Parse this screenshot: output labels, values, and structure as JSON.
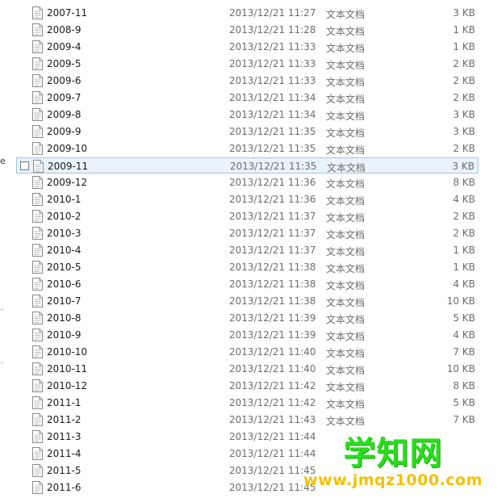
{
  "left_edge": {
    "glyph": "e"
  },
  "files": [
    {
      "name": "2007-11",
      "date": "2013/12/21 11:27",
      "type": "文本文档",
      "size": "3 KB"
    },
    {
      "name": "2008-9",
      "date": "2013/12/21 11:28",
      "type": "文本文档",
      "size": "1 KB"
    },
    {
      "name": "2009-4",
      "date": "2013/12/21 11:33",
      "type": "文本文档",
      "size": "1 KB"
    },
    {
      "name": "2009-5",
      "date": "2013/12/21 11:33",
      "type": "文本文档",
      "size": "2 KB"
    },
    {
      "name": "2009-6",
      "date": "2013/12/21 11:33",
      "type": "文本文档",
      "size": "2 KB"
    },
    {
      "name": "2009-7",
      "date": "2013/12/21 11:34",
      "type": "文本文档",
      "size": "2 KB"
    },
    {
      "name": "2009-8",
      "date": "2013/12/21 11:34",
      "type": "文本文档",
      "size": "3 KB"
    },
    {
      "name": "2009-9",
      "date": "2013/12/21 11:35",
      "type": "文本文档",
      "size": "3 KB"
    },
    {
      "name": "2009-10",
      "date": "2013/12/21 11:35",
      "type": "文本文档",
      "size": "2 KB"
    },
    {
      "name": "2009-11",
      "date": "2013/12/21 11:35",
      "type": "文本文档",
      "size": "3 KB",
      "selected": true
    },
    {
      "name": "2009-12",
      "date": "2013/12/21 11:36",
      "type": "文本文档",
      "size": "8 KB"
    },
    {
      "name": "2010-1",
      "date": "2013/12/21 11:36",
      "type": "文本文档",
      "size": "4 KB"
    },
    {
      "name": "2010-2",
      "date": "2013/12/21 11:37",
      "type": "文本文档",
      "size": "2 KB"
    },
    {
      "name": "2010-3",
      "date": "2013/12/21 11:37",
      "type": "文本文档",
      "size": "2 KB"
    },
    {
      "name": "2010-4",
      "date": "2013/12/21 11:37",
      "type": "文本文档",
      "size": "1 KB"
    },
    {
      "name": "2010-5",
      "date": "2013/12/21 11:38",
      "type": "文本文档",
      "size": "1 KB"
    },
    {
      "name": "2010-6",
      "date": "2013/12/21 11:38",
      "type": "文本文档",
      "size": "4 KB"
    },
    {
      "name": "2010-7",
      "date": "2013/12/21 11:38",
      "type": "文本文档",
      "size": "10 KB"
    },
    {
      "name": "2010-8",
      "date": "2013/12/21 11:39",
      "type": "文本文档",
      "size": "5 KB"
    },
    {
      "name": "2010-9",
      "date": "2013/12/21 11:39",
      "type": "文本文档",
      "size": "4 KB"
    },
    {
      "name": "2010-10",
      "date": "2013/12/21 11:40",
      "type": "文本文档",
      "size": "7 KB"
    },
    {
      "name": "2010-11",
      "date": "2013/12/21 11:40",
      "type": "文本文档",
      "size": "10 KB"
    },
    {
      "name": "2010-12",
      "date": "2013/12/21 11:42",
      "type": "文本文档",
      "size": "8 KB"
    },
    {
      "name": "2011-1",
      "date": "2013/12/21 11:42",
      "type": "文本文档",
      "size": "5 KB"
    },
    {
      "name": "2011-2",
      "date": "2013/12/21 11:43",
      "type": "文本文档",
      "size": "7 KB"
    },
    {
      "name": "2011-3",
      "date": "2013/12/21 11:44",
      "type": "",
      "size": ""
    },
    {
      "name": "2011-4",
      "date": "2013/12/21 11:44",
      "type": "",
      "size": ""
    },
    {
      "name": "2011-5",
      "date": "2013/12/21 11:45",
      "type": "",
      "size": ""
    },
    {
      "name": "2011-6",
      "date": "2013/12/21 11:45",
      "type": "",
      "size": ""
    }
  ],
  "watermark": {
    "title": "学知网",
    "url": "www.jmqz1000.com"
  },
  "colors": {
    "selection_bg": "#e9f3fb",
    "selection_border": "#9ec7e6",
    "secondary_text": "#6d6d6d",
    "watermark_green": "#2bdc1e",
    "watermark_yellow": "#f2c200"
  }
}
